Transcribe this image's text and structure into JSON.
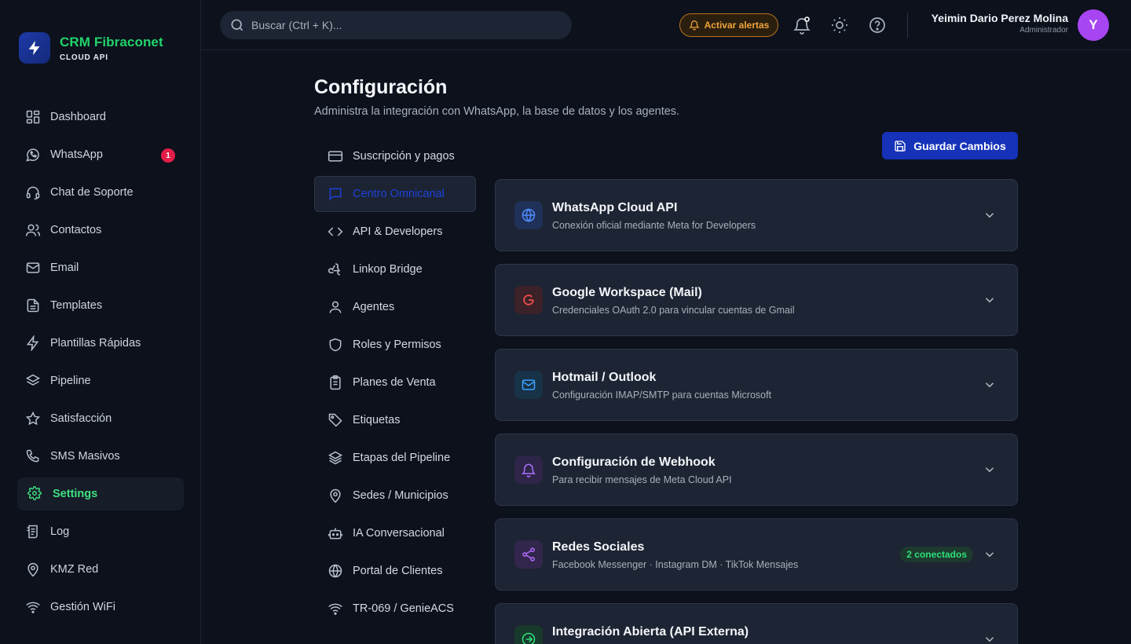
{
  "brand": {
    "name": "CRM Fibraconet",
    "sub": "CLOUD API"
  },
  "sidebar": {
    "items": [
      {
        "label": "Dashboard",
        "icon": "dashboard-icon"
      },
      {
        "label": "WhatsApp",
        "icon": "whatsapp-icon",
        "badge": "1"
      },
      {
        "label": "Chat de Soporte",
        "icon": "headset-icon"
      },
      {
        "label": "Contactos",
        "icon": "users-icon"
      },
      {
        "label": "Email",
        "icon": "mail-icon"
      },
      {
        "label": "Templates",
        "icon": "file-icon"
      },
      {
        "label": "Plantillas Rápidas",
        "icon": "bolt-icon"
      },
      {
        "label": "Pipeline",
        "icon": "layers-icon"
      },
      {
        "label": "Satisfacción",
        "icon": "star-icon"
      },
      {
        "label": "SMS Masivos",
        "icon": "phone-icon"
      },
      {
        "label": "Settings",
        "icon": "gear-icon",
        "active": true
      },
      {
        "label": "Log",
        "icon": "log-icon"
      },
      {
        "label": "KMZ Red",
        "icon": "map-pin-icon"
      },
      {
        "label": "Gestión WiFi",
        "icon": "wifi-icon"
      }
    ]
  },
  "header": {
    "search_placeholder": "Buscar (Ctrl + K)...",
    "alerts_label": "Activar alertas",
    "user_name": "Yeimin Dario Perez Molina",
    "user_role": "Administrador",
    "avatar_initial": "Y"
  },
  "page": {
    "title": "Configuración",
    "subtitle": "Administra la integración con WhatsApp, la base de datos y los agentes.",
    "save_label": "Guardar Cambios"
  },
  "settings_nav": [
    {
      "label": "Suscripción y pagos",
      "icon": "credit-card-icon"
    },
    {
      "label": "Centro Omnicanal",
      "icon": "chat-icon",
      "active": true
    },
    {
      "label": "API & Developers",
      "icon": "code-icon"
    },
    {
      "label": "Linkop Bridge",
      "icon": "webhook-icon"
    },
    {
      "label": "Agentes",
      "icon": "user-icon"
    },
    {
      "label": "Roles y Permisos",
      "icon": "shield-icon"
    },
    {
      "label": "Planes de Venta",
      "icon": "clipboard-icon"
    },
    {
      "label": "Etiquetas",
      "icon": "tag-icon"
    },
    {
      "label": "Etapas del Pipeline",
      "icon": "layers-icon"
    },
    {
      "label": "Sedes / Municipios",
      "icon": "map-pin-icon"
    },
    {
      "label": "IA Conversacional",
      "icon": "bot-icon"
    },
    {
      "label": "Portal de Clientes",
      "icon": "globe-icon"
    },
    {
      "label": "TR-069 / GenieACS",
      "icon": "wifi-icon"
    }
  ],
  "cards": [
    {
      "title": "WhatsApp Cloud API",
      "desc": "Conexión oficial mediante Meta for Developers",
      "icon": "globe-icon",
      "color": "#4f8dff",
      "bg": "#1f3158"
    },
    {
      "title": "Google Workspace (Mail)",
      "desc": "Credenciales OAuth 2.0 para vincular cuentas de Gmail",
      "icon": "google-icon",
      "color": "#ef4b4b",
      "bg": "#3a2228"
    },
    {
      "title": "Hotmail / Outlook",
      "desc": "Configuración IMAP/SMTP para cuentas Microsoft",
      "icon": "mail-icon",
      "color": "#3aa4ff",
      "bg": "#183248"
    },
    {
      "title": "Configuración de Webhook",
      "desc": "Para recibir mensajes de Meta Cloud API",
      "icon": "bell-icon",
      "color": "#a970ff",
      "bg": "#2e2548"
    },
    {
      "title": "Redes Sociales",
      "desc": "Facebook Messenger · Instagram DM · TikTok Mensajes",
      "icon": "share-icon",
      "color": "#b06cff",
      "bg": "#33264d",
      "badge": "2 conectados"
    },
    {
      "title": "Integración Abierta (API Externa)",
      "desc": "",
      "icon": "arrow-circle-icon",
      "color": "#2ee07a",
      "bg": "#173a2d"
    }
  ]
}
